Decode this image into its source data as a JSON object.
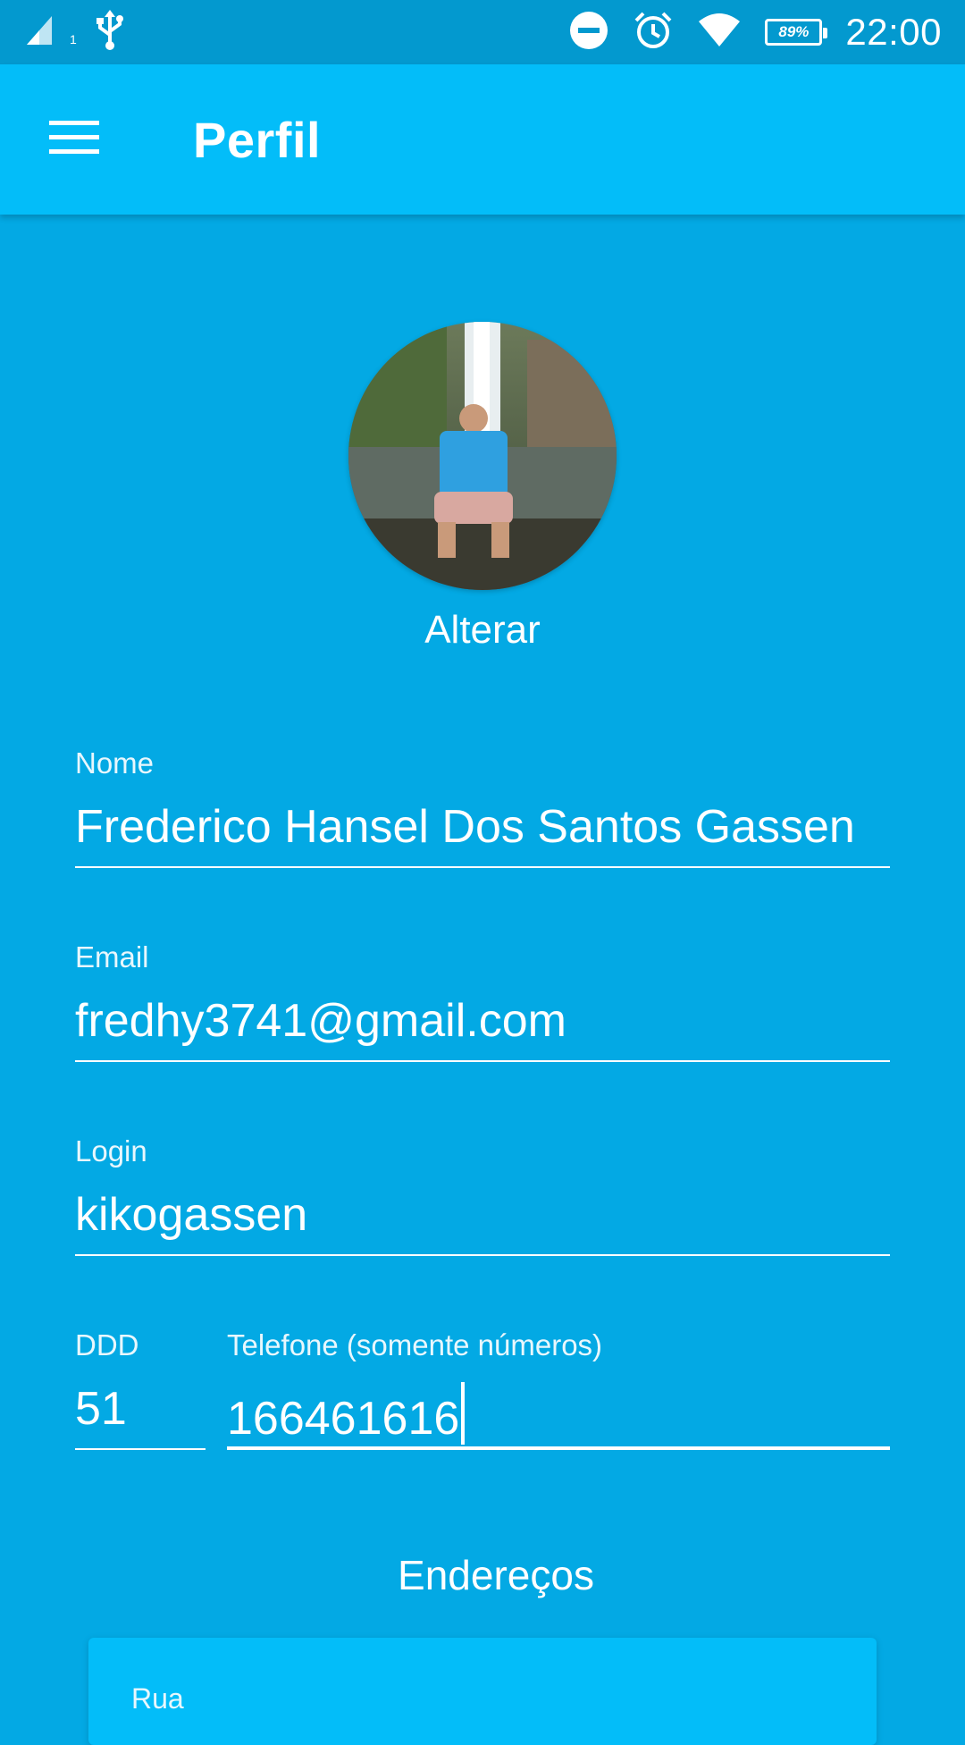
{
  "status_bar": {
    "signal_icon": "cell-signal-icon",
    "sim_number": "1",
    "usb_icon": "usb-icon",
    "dnd_icon": "do-not-disturb-icon",
    "alarm_icon": "alarm-icon",
    "wifi_icon": "wifi-icon",
    "battery": "89%",
    "time": "22:00"
  },
  "toolbar": {
    "menu_icon": "hamburger-menu-icon",
    "title": "Perfil"
  },
  "profile": {
    "avatar_icon": "profile-photo",
    "change_label": "Alterar"
  },
  "form": {
    "nome": {
      "label": "Nome",
      "value": "Frederico Hansel Dos Santos Gassen"
    },
    "email": {
      "label": "Email",
      "value": "fredhy3741@gmail.com"
    },
    "login": {
      "label": "Login",
      "value": "kikogassen"
    },
    "ddd": {
      "label": "DDD",
      "value": "51"
    },
    "telefone": {
      "label": "Telefone (somente números)",
      "value": "166461616"
    }
  },
  "addresses": {
    "title": "Endereços",
    "card": {
      "rua_label": "Rua"
    }
  },
  "colors": {
    "background": "#03A9E4",
    "toolbar": "#03BDF9",
    "status_bar": "#0399CF",
    "text": "#FFFFFF"
  }
}
